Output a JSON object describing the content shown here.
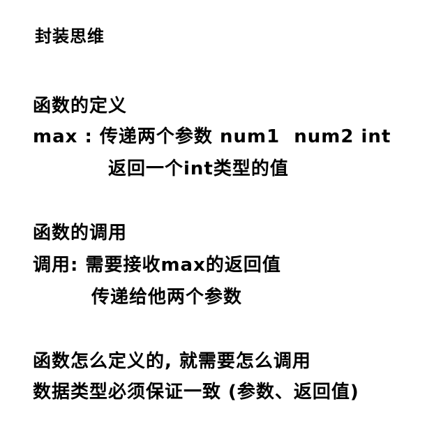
{
  "doc": {
    "heading": "封装思维",
    "section1": {
      "title": "函数的定义",
      "line1": "max : 传递两个参数 num1  num2 int",
      "line2": "返回一个int类型的值"
    },
    "section2": {
      "title": "函数的调用",
      "line1": "调用: 需要接收max的返回值",
      "line2": "传递给他两个参数"
    },
    "section3": {
      "line1": "函数怎么定义的, 就需要怎么调用",
      "line2": "数据类型必须保证一致 (参数、返回值)"
    }
  }
}
